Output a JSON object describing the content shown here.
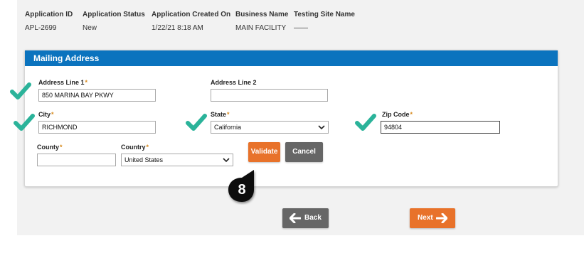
{
  "app_info": {
    "columns": [
      {
        "header": "Application ID",
        "value": "APL-2699"
      },
      {
        "header": "Application Status",
        "value": "New"
      },
      {
        "header": "Application Created On",
        "value": "1/22/21 8:18 AM"
      },
      {
        "header": "Business Name",
        "value": "MAIN FACILITY"
      },
      {
        "header": "Testing Site Name",
        "value": "——"
      }
    ]
  },
  "mailing": {
    "title": "Mailing Address",
    "address1": {
      "label": "Address Line 1",
      "value": "850 MARINA BAY PKWY"
    },
    "address2": {
      "label": "Address Line 2",
      "value": ""
    },
    "city": {
      "label": "City",
      "value": "RICHMOND"
    },
    "state": {
      "label": "State",
      "value": "California"
    },
    "zip": {
      "label": "Zip Code",
      "value": "94804"
    },
    "county": {
      "label": "County",
      "value": ""
    },
    "country": {
      "label": "Country",
      "value": "United States"
    },
    "required_mark": "*",
    "validate_label": "Validate",
    "cancel_label": "Cancel"
  },
  "step_badge": "8",
  "nav": {
    "back_label": "Back",
    "next_label": "Next"
  },
  "colors": {
    "header_blue": "#0b73be",
    "accent_orange": "#e8722a",
    "check_green": "#2bb39a",
    "back_gray": "#666666"
  }
}
